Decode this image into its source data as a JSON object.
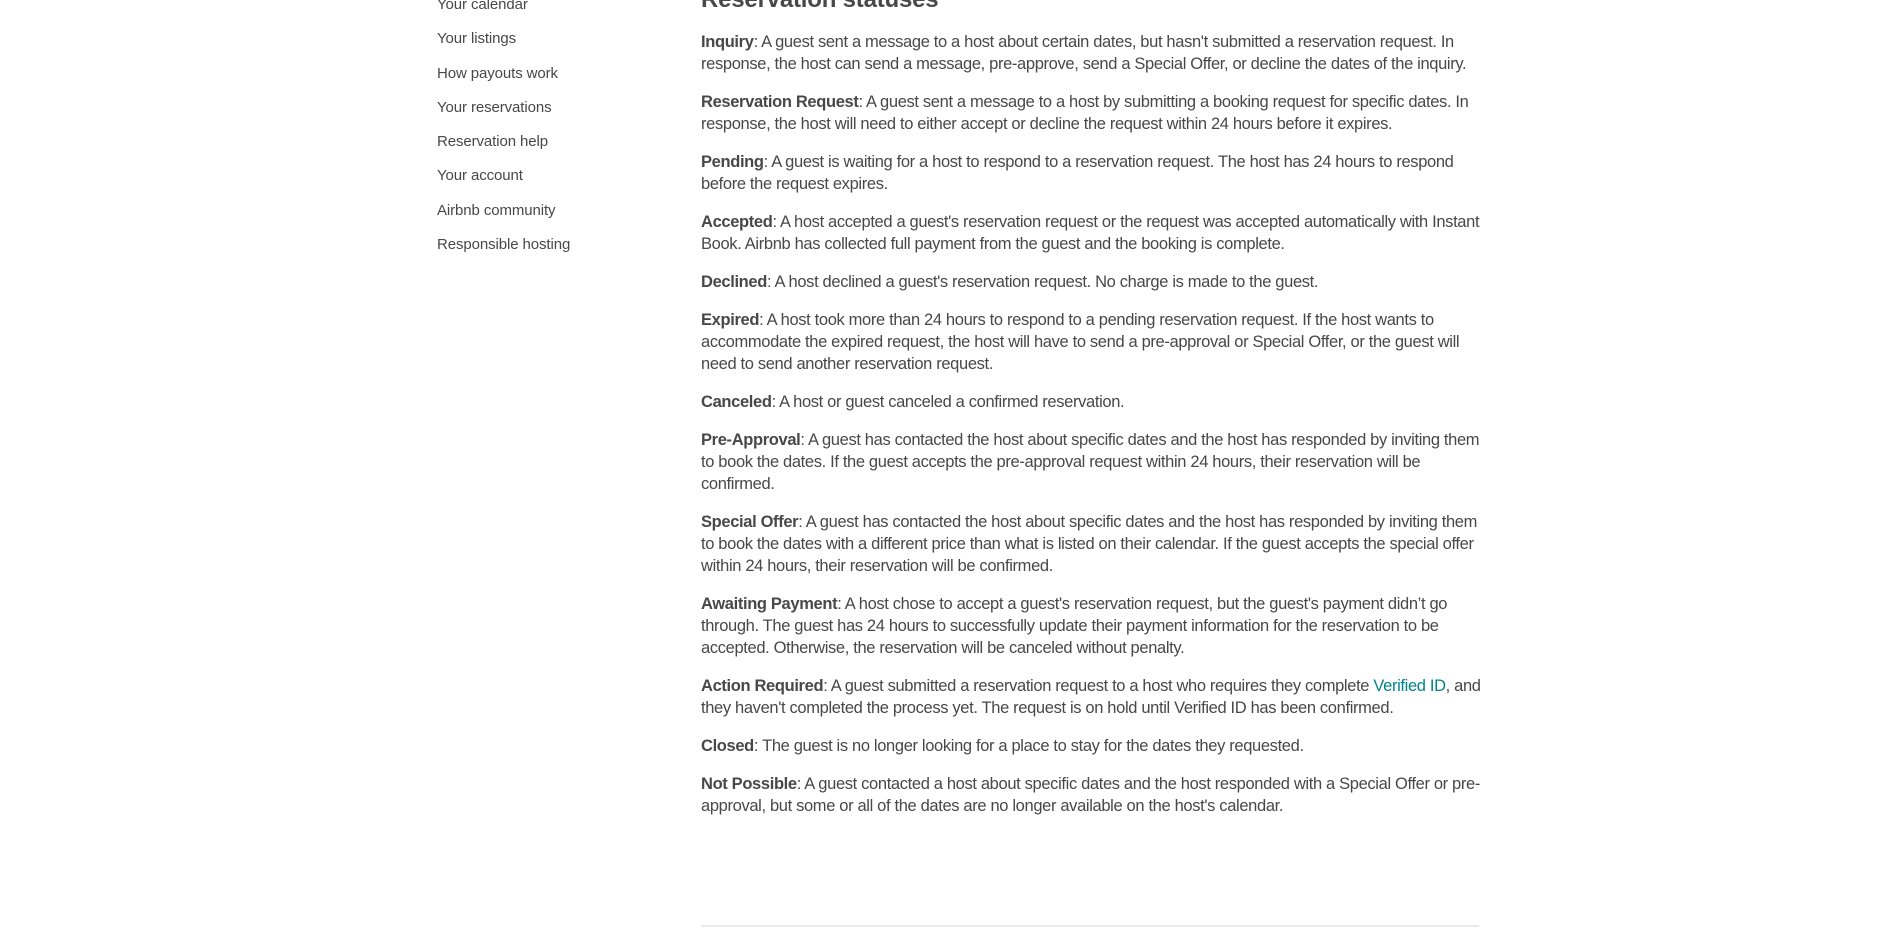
{
  "sidebar": {
    "items": [
      {
        "label": "Your calendar"
      },
      {
        "label": "Your listings"
      },
      {
        "label": "How payouts work"
      },
      {
        "label": "Your reservations"
      },
      {
        "label": "Reservation help"
      },
      {
        "label": "Your account"
      },
      {
        "label": "Airbnb community"
      },
      {
        "label": "Responsible hosting"
      }
    ]
  },
  "main": {
    "title": "Reservation statuses",
    "statuses": [
      {
        "term": "Inquiry",
        "text": ": A guest sent a message to a host about certain dates, but hasn't submitted a reservation request. In response, the host can send a message, pre-approve, send a Special Offer, or decline the dates of the inquiry."
      },
      {
        "term": "Reservation Request",
        "text": ": A guest sent a message to a host by submitting a booking request for specific dates. In response, the host will need to either accept or decline the request within 24 hours before it expires."
      },
      {
        "term": "Pending",
        "text": ": A guest is waiting for a host to respond to a reservation request. The host has 24 hours to respond before the request expires."
      },
      {
        "term": "Accepted",
        "text": ": A host accepted a guest's reservation request or the request was accepted automatically with Instant Book. Airbnb has collected full payment from the guest and the booking is complete."
      },
      {
        "term": "Declined",
        "text": ": A host declined a guest's reservation request. No charge is made to the guest."
      },
      {
        "term": "Expired",
        "text": ": A host took more than 24 hours to respond to a pending reservation request. If the host wants to accommodate the expired request, the host will have to send a pre-approval or Special Offer, or the guest will need to send another reservation request."
      },
      {
        "term": "Canceled",
        "text": ": A host or guest canceled a confirmed reservation."
      },
      {
        "term": "Pre-Approval",
        "text": ": A guest has contacted the host about specific dates and the host has responded by inviting them to book the dates. If the guest accepts the pre-approval request within 24 hours, their reservation will be confirmed."
      },
      {
        "term": "Special Offer",
        "text": ": A guest has contacted the host about specific dates and the host has responded by inviting them to book the dates with a different price than what is listed on their calendar. If the guest accepts the special offer within 24 hours, their reservation will be confirmed."
      },
      {
        "term": "Awaiting Payment",
        "text": ": A host chose to accept a guest's reservation request, but the guest's payment didn’t go through. The guest has 24 hours to successfully update their payment information for the reservation to be accepted. Otherwise, the reservation will be canceled without penalty."
      },
      {
        "term": "Action Required",
        "text_before": ": A guest submitted a reservation request to a host who requires they complete ",
        "link": "Verified ID",
        "text_after": ", and they haven't completed the process yet. The request is on hold until Verified ID has been confirmed."
      },
      {
        "term": "Closed",
        "text": ": The guest is no longer looking for a place to stay for the dates they requested."
      },
      {
        "term": "Not Possible",
        "text": ": A guest contacted a host about specific dates and the host responded with a Special Offer or pre-approval, but some or all of the dates are no longer available on the host's calendar."
      }
    ]
  },
  "colors": {
    "text": "#484848",
    "link": "#008489",
    "divider": "#ebebeb"
  }
}
